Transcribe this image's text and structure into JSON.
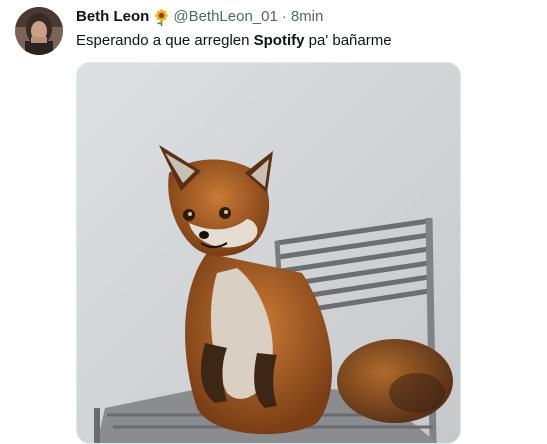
{
  "tweet": {
    "author": {
      "display_name": "Beth Leon",
      "name_emoji": "sunflower-icon",
      "handle": "@BethLeon_01"
    },
    "separator": "·",
    "time": "8min",
    "text": {
      "before": "Esperando a que arreglen ",
      "bold": "Spotify",
      "after": " pa' bañarme"
    },
    "media": {
      "subject": "stuffed fox sitting on a metal chair"
    }
  },
  "colors": {
    "text_primary": "#0f1419",
    "text_secondary": "#536471",
    "background": "#ffffff"
  }
}
